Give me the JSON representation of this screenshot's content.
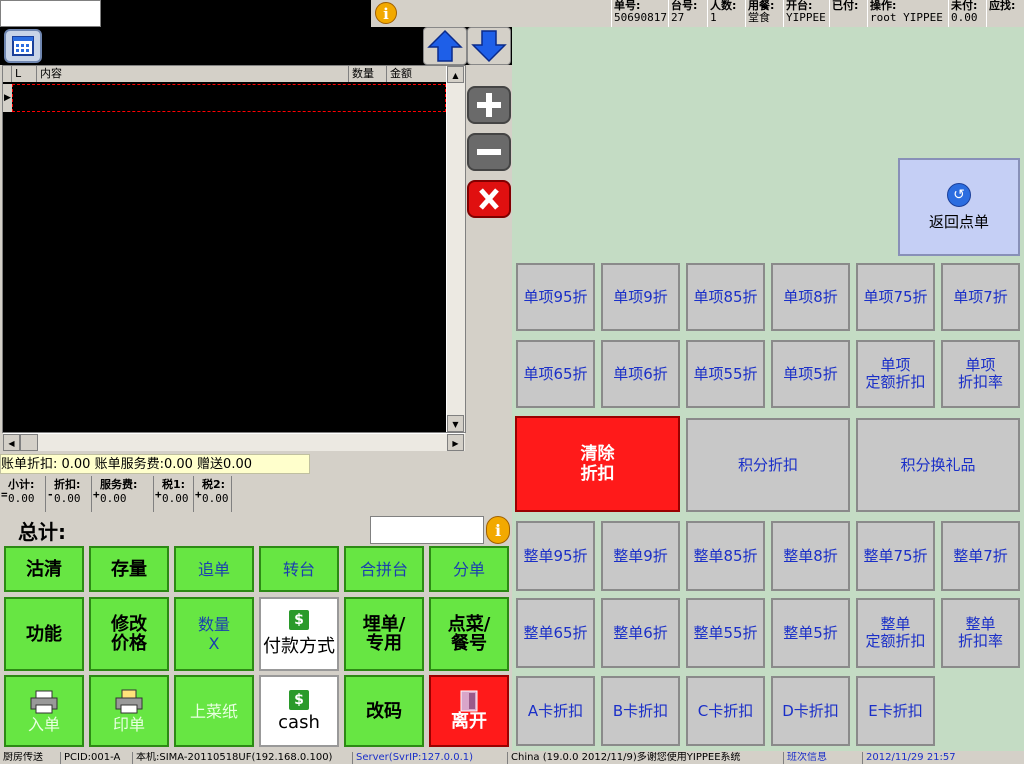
{
  "header": {
    "order_no_label": "单号:",
    "order_no": "50690817",
    "table_no_label": "台号:",
    "table_no": "27",
    "guests_label": "人数:",
    "guests": "1",
    "dining_label": "用餐:",
    "dining": "堂食",
    "opened_by_label": "开台:",
    "opened_by": "YIPPEE",
    "paid_label": "已付:",
    "paid": "",
    "operator_label": "操作:",
    "operator": "root YIPPEE",
    "unpaid_label": "未付:",
    "unpaid": "0.00",
    "change_label": "应找:",
    "change": ""
  },
  "grid": {
    "columns": [
      "L",
      "内容",
      "数量",
      "金额"
    ]
  },
  "summary": {
    "line1": "账单折扣: 0.00 账单服务费:0.00 赠送0.00",
    "subtotal_label": "小计:",
    "subtotal": "0.00",
    "discount_label": "折扣:",
    "discount": "0.00",
    "service_label": "服务费:",
    "service": "0.00",
    "tax1_label": "税1:",
    "tax1": "0.00",
    "tax2_label": "税2:",
    "tax2": "0.00",
    "total_label": "总计:"
  },
  "green_buttons": {
    "b1": "沽清",
    "b2": "存量",
    "b3": "追单",
    "b4": "转台",
    "b5": "合拼台",
    "b6": "分单",
    "b7": "功能",
    "b8a": "修改",
    "b8b": "价格",
    "b9a": "数量",
    "b9b": "X",
    "b10": "付款方式",
    "b11a": "埋单/",
    "b11b": "专用",
    "b12a": "点菜/",
    "b12b": "餐号",
    "b13": "入单",
    "b14": "印单",
    "b15": "上菜纸",
    "b16": "cash",
    "b17": "改码",
    "b18": "离开"
  },
  "right": {
    "back": "返回点单",
    "row1": [
      "单项95折",
      "单项9折",
      "单项85折",
      "单项8折",
      "单项75折",
      "单项7折"
    ],
    "row2": [
      "单项65折",
      "单项6折",
      "单项55折",
      "单项5折"
    ],
    "row2_fixed_a": "单项",
    "row2_fixed_b": "定额折扣",
    "row2_rate_a": "单项",
    "row2_rate_b": "折扣率",
    "clear_a": "清除",
    "clear_b": "折扣",
    "points": "积分折扣",
    "points_gift": "积分换礼品",
    "row4": [
      "整单95折",
      "整单9折",
      "整单85折",
      "整单8折",
      "整单75折",
      "整单7折"
    ],
    "row5": [
      "整单65折",
      "整单6折",
      "整单55折",
      "整单5折"
    ],
    "row5_fixed_a": "整单",
    "row5_fixed_b": "定额折扣",
    "row5_rate_a": "整单",
    "row5_rate_b": "折扣率",
    "cards": [
      "A卡折扣",
      "B卡折扣",
      "C卡折扣",
      "D卡折扣",
      "E卡折扣"
    ]
  },
  "status": {
    "s1": "厨房传送",
    "s2": "PCID:001-A",
    "s3": "本机:SIMA-20110518UF(192.168.0.100)",
    "s4": "Server(SvrIP:127.0.0.1)",
    "s5": "China (19.0.0 2012/11/9)多谢您使用YIPPEE系统",
    "s6": "班次信息",
    "s7": "2012/11/29 21:57"
  }
}
